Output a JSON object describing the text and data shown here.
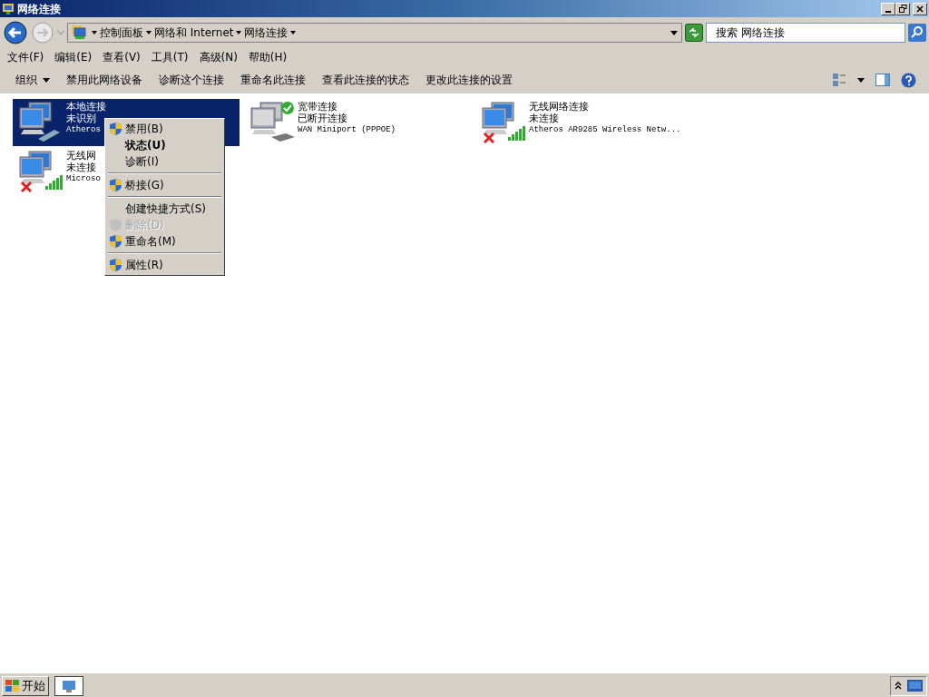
{
  "window": {
    "title": "网络连接"
  },
  "address": {
    "crumbs": [
      "控制面板",
      "网络和 Internet",
      "网络连接"
    ]
  },
  "search": {
    "placeholder": "搜索 网络连接"
  },
  "menu_bar": [
    "文件(F)",
    "编辑(E)",
    "查看(V)",
    "工具(T)",
    "高级(N)",
    "帮助(H)"
  ],
  "command_bar": [
    {
      "label": "组织",
      "dropdown": true
    },
    {
      "label": "禁用此网络设备",
      "dropdown": false
    },
    {
      "label": "诊断这个连接",
      "dropdown": false
    },
    {
      "label": "重命名此连接",
      "dropdown": false
    },
    {
      "label": "查看此连接的状态",
      "dropdown": false
    },
    {
      "label": "更改此连接的设置",
      "dropdown": false
    }
  ],
  "connections": [
    {
      "name": "本地连接",
      "status": "未识别",
      "device": "Atheros",
      "selected": true,
      "kind": "cable",
      "connected": false,
      "error": false
    },
    {
      "name": "宽带连接",
      "status": "已断开连接",
      "device": "WAN Miniport (PPPOE)",
      "selected": false,
      "kind": "modem",
      "connected": true,
      "error": false
    },
    {
      "name": "无线网络连接",
      "status": "未连接",
      "device": "Atheros AR9285 Wireless Netw...",
      "selected": false,
      "kind": "wireless",
      "connected": false,
      "error": true
    },
    {
      "name": "无线网",
      "status": "未连接",
      "device": "Microso",
      "selected": false,
      "kind": "wireless",
      "connected": false,
      "error": true
    }
  ],
  "context_menu": [
    {
      "kind": "item",
      "label": "禁用(B)",
      "shield": true,
      "default": false,
      "disabled": false
    },
    {
      "kind": "item",
      "label": "状态(U)",
      "shield": false,
      "default": true,
      "disabled": false
    },
    {
      "kind": "item",
      "label": "诊断(I)",
      "shield": false,
      "default": false,
      "disabled": false
    },
    {
      "kind": "separator"
    },
    {
      "kind": "item",
      "label": "桥接(G)",
      "shield": true,
      "default": false,
      "disabled": false
    },
    {
      "kind": "separator"
    },
    {
      "kind": "item",
      "label": "创建快捷方式(S)",
      "shield": false,
      "default": false,
      "disabled": false
    },
    {
      "kind": "item",
      "label": "删除(D)",
      "shield": true,
      "default": false,
      "disabled": true
    },
    {
      "kind": "item",
      "label": "重命名(M)",
      "shield": true,
      "default": false,
      "disabled": false
    },
    {
      "kind": "separator"
    },
    {
      "kind": "item",
      "label": "属性(R)",
      "shield": true,
      "default": false,
      "disabled": false
    }
  ],
  "taskbar": {
    "start": "开始"
  }
}
